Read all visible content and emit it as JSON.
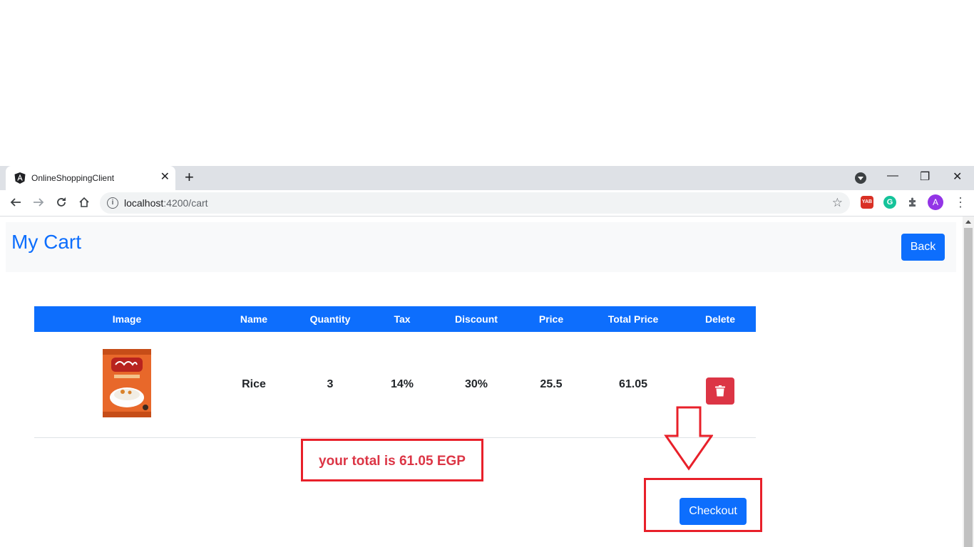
{
  "browser": {
    "tab_title": "OnlineShoppingClient",
    "new_tab_symbol": "+",
    "url_host": "localhost",
    "url_path": ":4200/cart",
    "ext_yab": "YAB",
    "ext_g": "G",
    "avatar_letter": "A"
  },
  "page": {
    "title": "My Cart",
    "back_label": "Back"
  },
  "table": {
    "headers": [
      "Image",
      "Name",
      "Quantity",
      "Tax",
      "Discount",
      "Price",
      "Total Price",
      "Delete"
    ],
    "rows": [
      {
        "name": "Rice",
        "quantity": "3",
        "tax": "14%",
        "discount": "30%",
        "price": "25.5",
        "total_price": "61.05"
      }
    ]
  },
  "summary": {
    "total_text": "your total is 61.05 EGP"
  },
  "checkout_label": "Checkout",
  "colors": {
    "primary": "#0d6efd",
    "danger": "#dc3545",
    "annotation": "#e8202a"
  }
}
